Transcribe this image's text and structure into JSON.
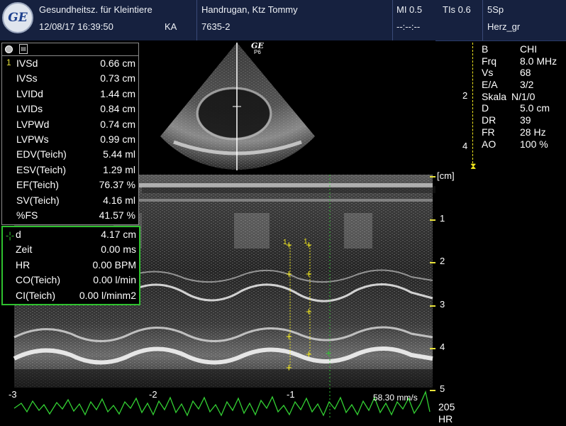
{
  "header": {
    "logo": "GE",
    "institution": "Gesundheitsz. für Kleintiere",
    "datetime": "12/08/17 16:39:50",
    "operator": "KA",
    "patient": "Handrugan, Ktz Tommy",
    "patient_id": "7635-2",
    "mi": "MI 0.5",
    "tis": "TIs 0.6",
    "probe": "5Sp",
    "blank_time": "--:--:--",
    "preset": "Herz_gr"
  },
  "probe_label": "GE",
  "probe_sub": "P6",
  "measurements": {
    "index": "1",
    "rows": [
      {
        "label": "IVSd",
        "value": "0.66 cm"
      },
      {
        "label": "IVSs",
        "value": "0.73 cm"
      },
      {
        "label": "LVIDd",
        "value": "1.44 cm"
      },
      {
        "label": "LVIDs",
        "value": "0.84 cm"
      },
      {
        "label": "LVPWd",
        "value": "0.74 cm"
      },
      {
        "label": "LVPWs",
        "value": "0.99 cm"
      },
      {
        "label": "EDV(Teich)",
        "value": "5.44 ml"
      },
      {
        "label": "ESV(Teich)",
        "value": "1.29 ml"
      },
      {
        "label": "EF(Teich)",
        "value": "76.37 %"
      },
      {
        "label": "SV(Teich)",
        "value": "4.16 ml"
      },
      {
        "label": "%FS",
        "value": "41.57 %"
      }
    ]
  },
  "active_measurement": {
    "rows": [
      {
        "label": "d",
        "value": "4.17 cm"
      },
      {
        "label": "Zeit",
        "value": "0.00 ms"
      },
      {
        "label": "HR",
        "value": "0.00 BPM"
      },
      {
        "label": "CO(Teich)",
        "value": "0.00 l/min"
      },
      {
        "label": "CI(Teich)",
        "value": "0.00 l/minm2"
      }
    ]
  },
  "parameters": [
    {
      "key": "B",
      "value": "CHI"
    },
    {
      "key": "Frq",
      "value": "8.0 MHz"
    },
    {
      "key": "Vs",
      "value": "68"
    },
    {
      "key": "E/A",
      "value": "3/2"
    },
    {
      "key": "Skala",
      "value": "N/1/0"
    },
    {
      "key": "D",
      "value": "5.0 cm"
    },
    {
      "key": "DR",
      "value": "39"
    },
    {
      "key": "FR",
      "value": "28 Hz"
    },
    {
      "key": "AO",
      "value": "100 %"
    }
  ],
  "gain_marks": [
    "2",
    "4"
  ],
  "depth_unit": "[cm]",
  "depth_marks": [
    "1",
    "2",
    "3",
    "4",
    "5"
  ],
  "time_marks": [
    "-3",
    "-2",
    "-1"
  ],
  "sweep_speed": "58.30 mm/s",
  "hr_value": "205",
  "hr_label": "HR",
  "caliper_labels": [
    "1",
    "1"
  ],
  "colors": {
    "caliper": "#f2e81e",
    "ecg": "#33d033",
    "active_border": "#2ec12e",
    "header_bg": "#16213f"
  }
}
